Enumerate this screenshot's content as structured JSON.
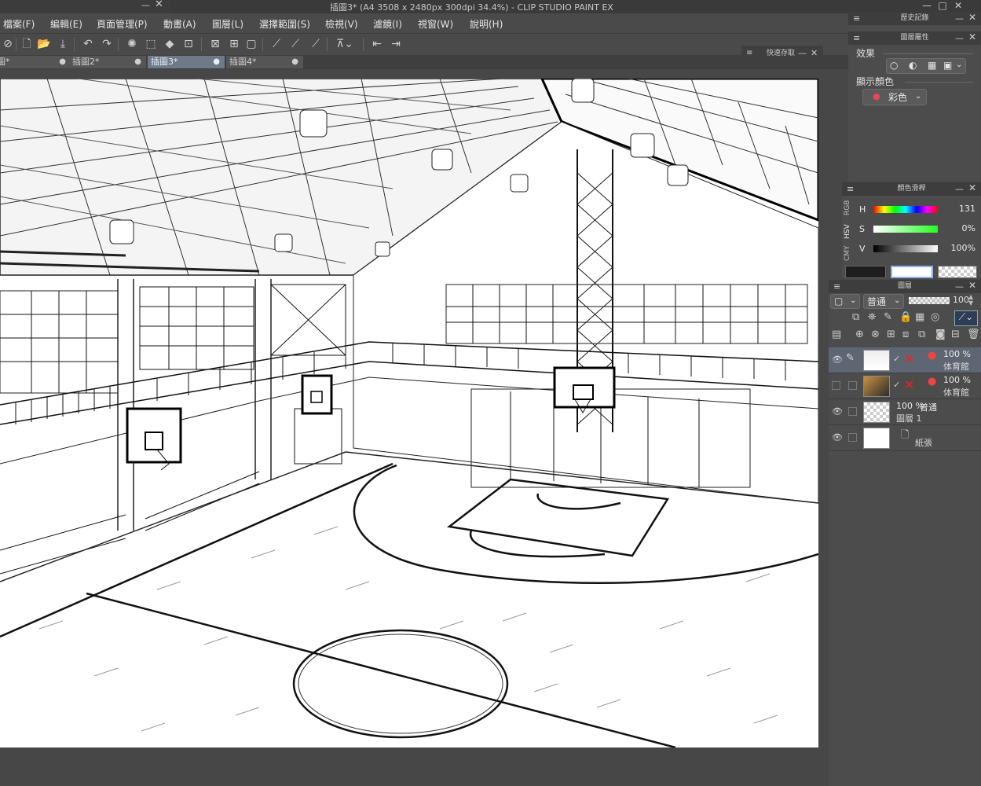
{
  "window": {
    "title": "插圖3* (A4 3508 x 2480px 300dpi 34.4%)  - CLIP STUDIO PAINT EX",
    "minimize": "—",
    "restore": "□",
    "close": "✕"
  },
  "menu": {
    "items": [
      "檔案(F)",
      "編輯(E)",
      "頁面管理(P)",
      "動畫(A)",
      "圖層(L)",
      "選擇範圍(S)",
      "檢視(V)",
      "濾鏡(I)",
      "視窗(W)",
      "說明(H)"
    ]
  },
  "doc_tabs": [
    {
      "label": "圖*"
    },
    {
      "label": "插圖2*"
    },
    {
      "label": "插圖3*"
    },
    {
      "label": "插圖4*"
    }
  ],
  "quick_save": {
    "label": "快速存取"
  },
  "history_panel": {
    "title": "歷史記錄"
  },
  "layer_property_panel": {
    "title": "圖層屬性",
    "effect_label": "效果",
    "display_color_label": "顯示顏色",
    "display_color_value": "彩色"
  },
  "color_panel": {
    "title": "顏色滑桿",
    "side_tabs": [
      "RGB",
      "HSV",
      "CMY"
    ],
    "h": {
      "label": "H",
      "value": "131"
    },
    "s": {
      "label": "S",
      "value": "0%"
    },
    "v": {
      "label": "V",
      "value": "100%"
    }
  },
  "layer_panel": {
    "title": "圖層",
    "blend_mode": "普通",
    "opacity": "100",
    "layers": [
      {
        "pct": "100 %",
        "name": "体育館",
        "visible": true,
        "active": true
      },
      {
        "pct": "100 %",
        "name": "体育館",
        "visible": false,
        "active": false
      },
      {
        "pct": "100 %",
        "mode": "普通",
        "name": "圖層 1",
        "visible": true,
        "active": false
      },
      {
        "name": "紙張",
        "visible": true,
        "active": false
      }
    ]
  },
  "colors": {
    "bg": "#474747",
    "panel": "#4c4c4c",
    "active_tab": "#6f7a88",
    "active_layer": "#5e6673"
  }
}
